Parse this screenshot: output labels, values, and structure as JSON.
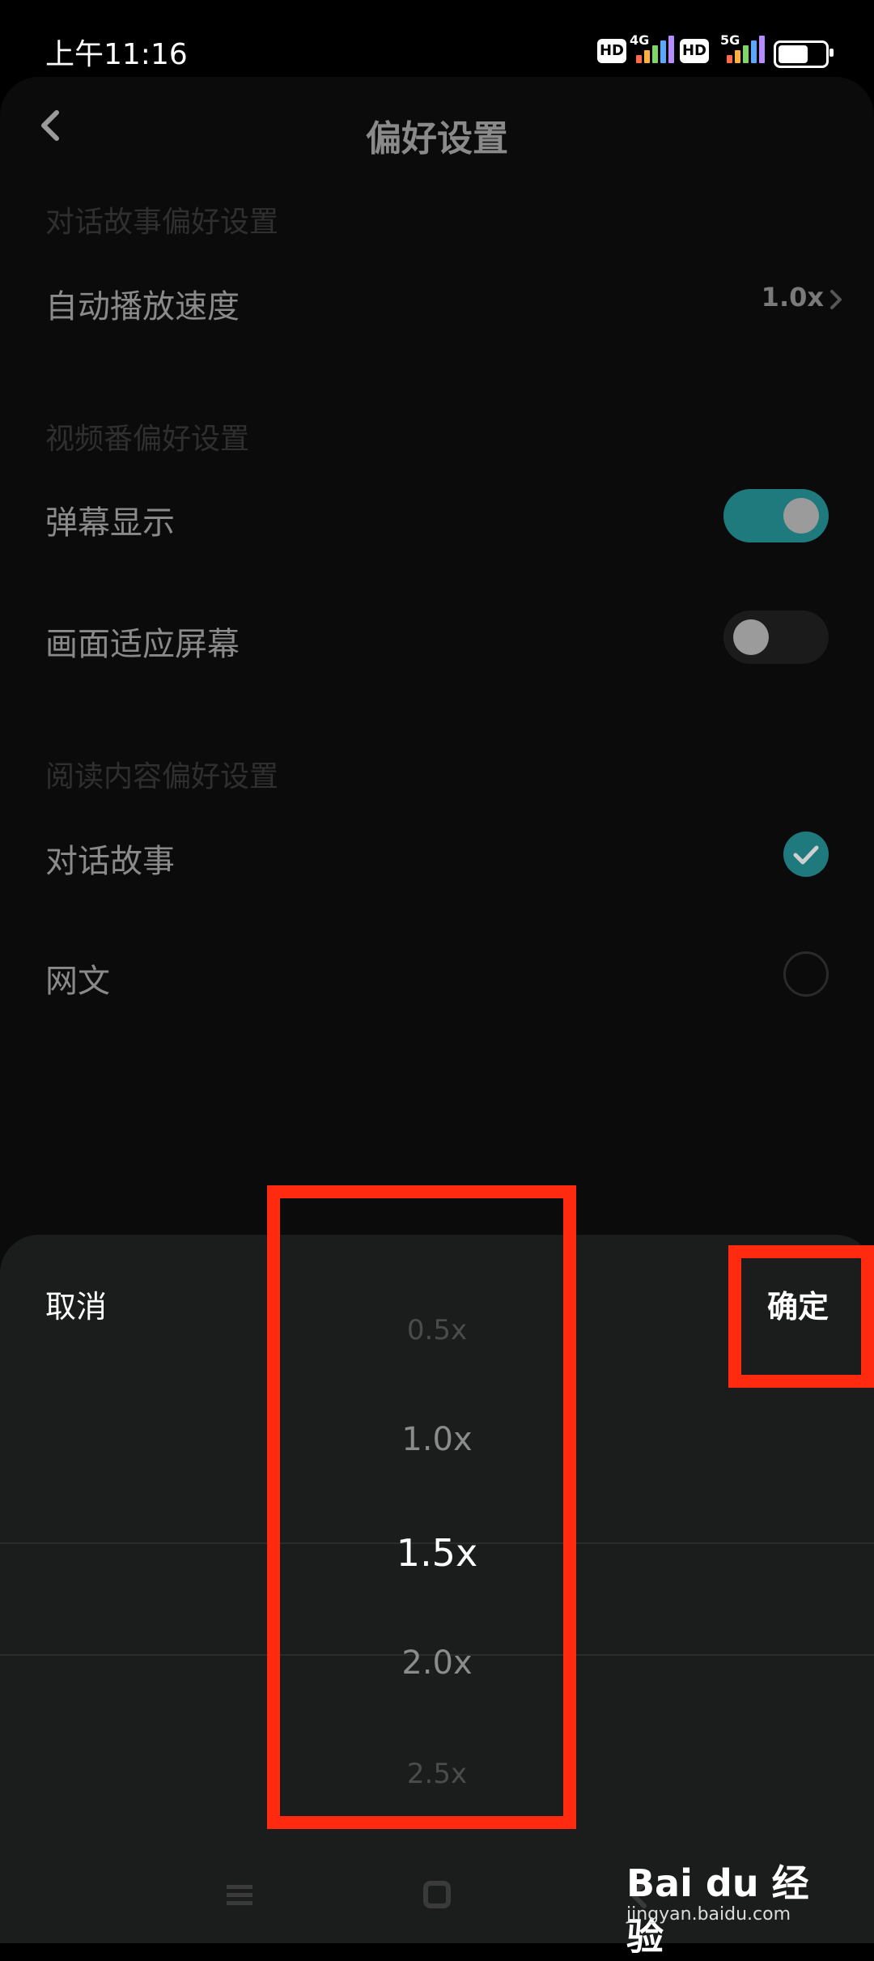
{
  "status_bar": {
    "time": "上午11:16",
    "hd_badge": "HD",
    "net1": "4G",
    "net2": "5G"
  },
  "header": {
    "title": "偏好设置"
  },
  "sections": [
    {
      "title": "对话故事偏好设置"
    },
    {
      "title": "视频番偏好设置"
    },
    {
      "title": "阅读内容偏好设置"
    }
  ],
  "rows": {
    "auto_play_speed": {
      "label": "自动播放速度",
      "value": "1.0x"
    },
    "danmaku": {
      "label": "弹幕显示",
      "enabled": true
    },
    "fit_screen": {
      "label": "画面适应屏幕",
      "enabled": false
    },
    "dialogue_story": {
      "label": "对话故事",
      "checked": true
    },
    "web_novel": {
      "label": "网文",
      "checked": false
    }
  },
  "sheet": {
    "cancel": "取消",
    "confirm": "确定",
    "options": [
      "0.5x",
      "1.0x",
      "1.5x",
      "2.0x",
      "2.5x"
    ],
    "selected": "1.5x"
  },
  "watermark": {
    "brand": "Bai du 经验",
    "sub": "jingyan.baidu.com"
  },
  "colors": {
    "accent": "#1f7a7d",
    "annotation": "#ff2a10"
  }
}
